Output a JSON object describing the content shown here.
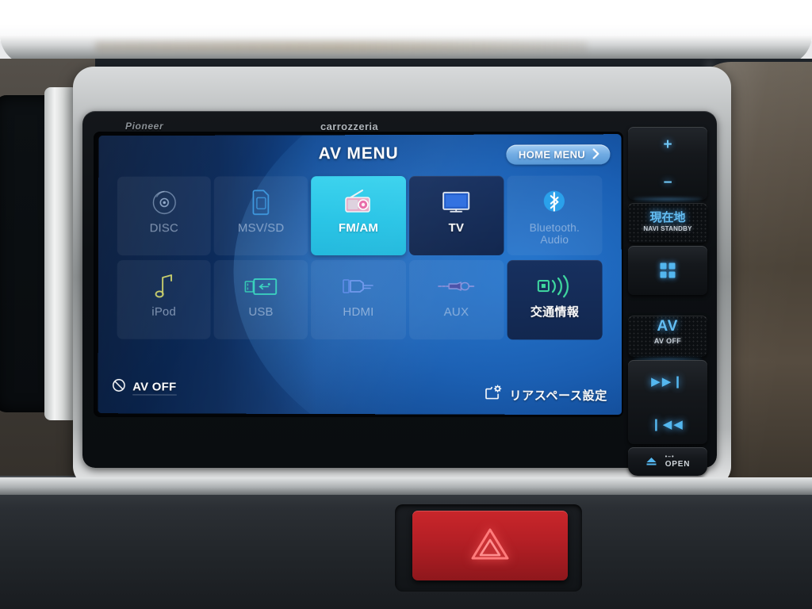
{
  "device": {
    "brand_left": "Pioneer",
    "brand_center": "carrozzeria"
  },
  "screen": {
    "title": "AV MENU",
    "home_menu": {
      "label": "HOME MENU",
      "chevron": "›",
      "icon": "chevron-right-icon"
    },
    "accent_active": "#27c4e6",
    "accent_tile_dark": "#14295a",
    "background_blue": "#12468d",
    "menu_items": [
      {
        "label": "DISC",
        "icon": "disc-icon",
        "state": "disabled"
      },
      {
        "label": "MSV/SD",
        "icon": "sd-card-icon",
        "state": "disabled"
      },
      {
        "label": "FM/AM",
        "icon": "radio-icon",
        "state": "selected"
      },
      {
        "label": "TV",
        "icon": "tv-icon",
        "state": "enabled"
      },
      {
        "label": "Bluetooth.\nAudio",
        "icon": "bluetooth-icon",
        "state": "disabled"
      },
      {
        "label": "iPod",
        "icon": "music-note-icon",
        "state": "disabled"
      },
      {
        "label": "USB",
        "icon": "usb-icon",
        "state": "disabled"
      },
      {
        "label": "HDMI",
        "icon": "hdmi-icon",
        "state": "disabled"
      },
      {
        "label": "AUX",
        "icon": "aux-jack-icon",
        "state": "disabled"
      },
      {
        "label": "交通情報",
        "icon": "broadcast-icon",
        "state": "enabled"
      }
    ],
    "av_off": {
      "label": "AV OFF",
      "icon": "crossed-circle-icon"
    },
    "rear_space": {
      "label": "リアスペース設定",
      "icon": "screen-gear-icon"
    }
  },
  "hardware_buttons": {
    "volume_up": "+",
    "volume_down": "−",
    "navi": {
      "label": "現在地",
      "sublabel": "NAVI STANDBY"
    },
    "menu_grid": {
      "icon": "grid-four-squares-icon"
    },
    "av": {
      "label": "AV",
      "sublabel": "AV OFF"
    },
    "track_next": "▶▶❙",
    "track_prev": "❙◀◀",
    "open": {
      "label": "OPEN",
      "dots": "•–•",
      "icon": "eject-icon"
    }
  },
  "dashboard": {
    "hazard": {
      "icon": "hazard-triangle-icon",
      "color": "#c9262b"
    }
  }
}
